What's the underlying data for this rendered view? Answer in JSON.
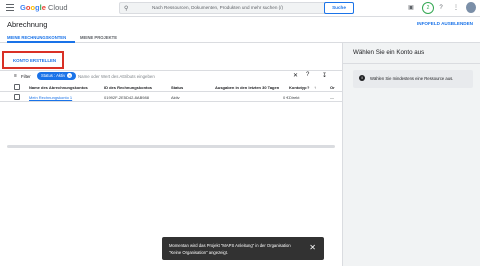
{
  "topbar": {
    "menu_icon": "menu-icon",
    "logo": {
      "google": "Google",
      "cloud": "Cloud"
    },
    "search_placeholder": "Nach Ressourcen, Dokumenten, Produkten und mehr suchen (/)",
    "search_button": "Suche",
    "icons": [
      "console-icon",
      "gift-badge",
      "help-icon",
      "more-icon",
      "avatar"
    ],
    "badge_text": "2"
  },
  "page": {
    "title": "Abrechnung",
    "info_panel_toggle": "INFOFELD AUSBLENDEN"
  },
  "tabs": [
    {
      "label": "MEINE RECHNUNGSKONTEN",
      "active": true
    },
    {
      "label": "MEINE PROJEKTE",
      "active": false
    }
  ],
  "actions": {
    "create_account": "KONTO ERSTELLEN"
  },
  "filter": {
    "label": "Filter",
    "chip": "Status : Aktiv",
    "placeholder": "Name oder Wert des Attributs eingeben"
  },
  "table": {
    "columns": [
      "Name des Abrechnungskontos",
      "ID des Rechnungskontos",
      "Status",
      "Ausgaben in den letzten 30 Tagen",
      "Kontotyp",
      "Or"
    ],
    "rows": [
      {
        "name": "Mein Rechnungskonto 1",
        "id": "01992F-2E5D42-8AB988",
        "status": "Aktiv",
        "spend": "0 €",
        "type": "Direkt",
        "org": "—"
      }
    ]
  },
  "side_panel": {
    "title": "Wählen Sie ein Konto aus",
    "info": "Wählen Sie mindestens eine Ressource aus."
  },
  "snackbar": {
    "message": "Momentan wird das Projekt \"MAPS Anleitung\" in der Organisation \"Keine Organisation\" angezeigt."
  },
  "colors": {
    "accent": "#1a73e8",
    "highlight": "#d93025",
    "snackbar": "#323232"
  }
}
